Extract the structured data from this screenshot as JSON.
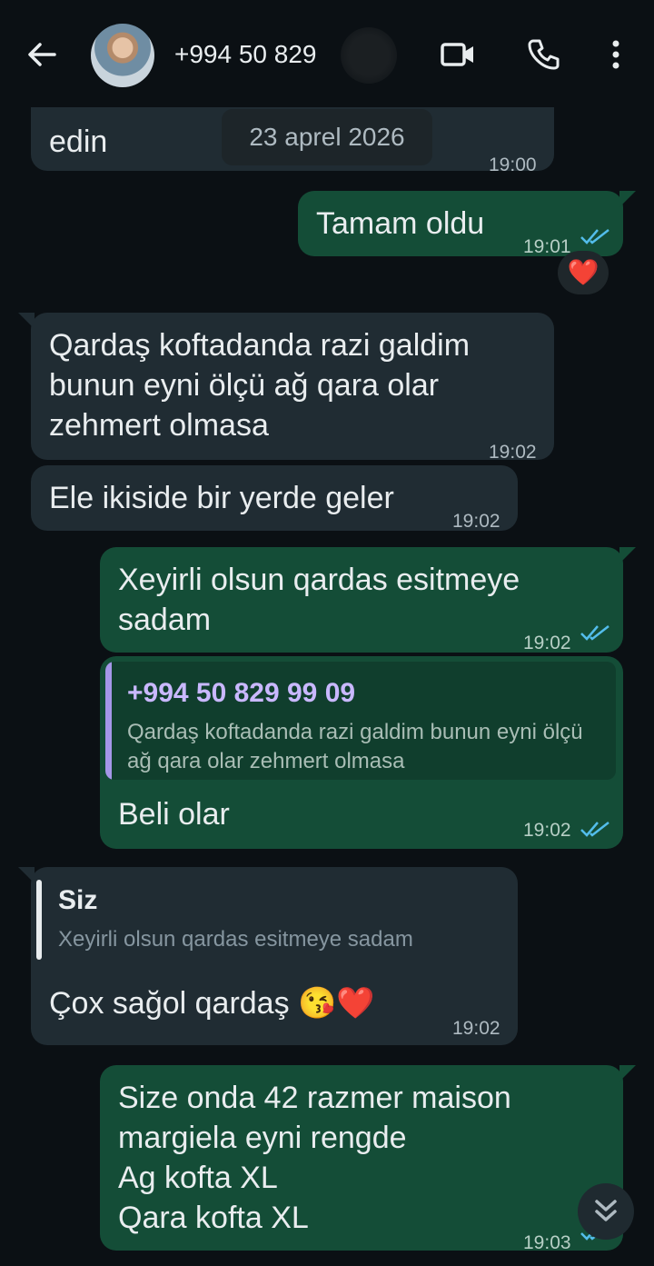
{
  "header": {
    "contact_name": "+994 50 829",
    "icons": [
      "back-arrow-icon",
      "video-call-icon",
      "phone-icon",
      "more-vert-icon"
    ]
  },
  "date_divider": "23 aprel 2026",
  "messages": [
    {
      "dir": "in",
      "text": "edin",
      "time": "19:00"
    },
    {
      "dir": "out",
      "text": "Tamam oldu",
      "time": "19:01",
      "status": "read",
      "reaction": "❤️"
    },
    {
      "dir": "in",
      "text": "Qardaş koftadanda razi galdim\nbunun eyni ölçü ağ qara olar\nzehmert olmasa",
      "time": "19:02"
    },
    {
      "dir": "in",
      "text": "Ele ikiside bir yerde geler",
      "time": "19:02"
    },
    {
      "dir": "out",
      "text": "Xeyirli olsun qardas esitmeye\nsadam",
      "time": "19:02",
      "status": "read"
    },
    {
      "dir": "out",
      "quote": {
        "name": "+994 50 829 99 09",
        "text": "Qardaş koftadanda razi galdim bunun eyni ölçü ağ qara olar zehmert olmasa"
      },
      "text": "Beli olar",
      "time": "19:02",
      "status": "read"
    },
    {
      "dir": "in",
      "quote": {
        "name": "Siz",
        "text": "Xeyirli olsun qardas esitmeye sadam"
      },
      "text": "Çox sağol qardaş 😘❤️",
      "time": "19:02"
    },
    {
      "dir": "out",
      "text": "Size onda 42 razmer maison\nmargiela eyni rengde\nAg kofta XL\nQara kofta XL",
      "time": "19:03",
      "status": "read"
    }
  ],
  "colors": {
    "background": "#0b1014",
    "incoming": "#202c33",
    "outgoing": "#144d37",
    "read_ticks": "#53bdeb"
  }
}
